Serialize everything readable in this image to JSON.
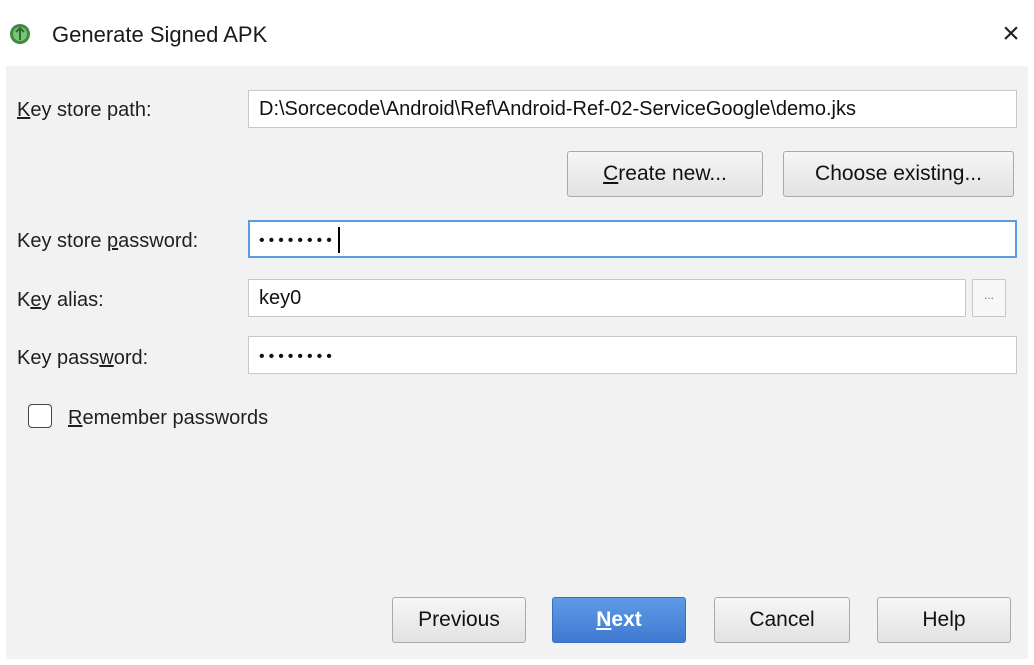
{
  "window": {
    "title": "Generate Signed APK",
    "close_glyph": "×",
    "app_icon": "android-studio-icon"
  },
  "form": {
    "key_store_path": {
      "label_underline": "K",
      "label_rest": "ey store path:",
      "value": "D:\\Sorcecode\\Android\\Ref\\Android-Ref-02-ServiceGoogle\\demo.jks"
    },
    "create_new": {
      "label_underline": "C",
      "label_rest": "reate new..."
    },
    "choose_existing": {
      "label": "Choose existing..."
    },
    "key_store_password": {
      "label_pre": "Key store ",
      "label_underline": "p",
      "label_rest": "assword:",
      "masked_value": "••••••••"
    },
    "key_alias": {
      "label_pre": "K",
      "label_underline": "e",
      "label_rest": "y alias:",
      "value": "key0",
      "browse_label": "..."
    },
    "key_password": {
      "label_pre": "Key pass",
      "label_underline": "w",
      "label_rest": "ord:",
      "masked_value": "••••••••"
    },
    "remember_passwords": {
      "label_underline": "R",
      "label_rest": "emember passwords",
      "checked": false
    }
  },
  "footer": {
    "previous": "Previous",
    "next_underline": "N",
    "next_rest": "ext",
    "cancel": "Cancel",
    "help": "Help"
  },
  "colors": {
    "accent": "#4a86dc",
    "focus_border": "#5b9be0",
    "panel_bg": "#f2f2f2"
  }
}
